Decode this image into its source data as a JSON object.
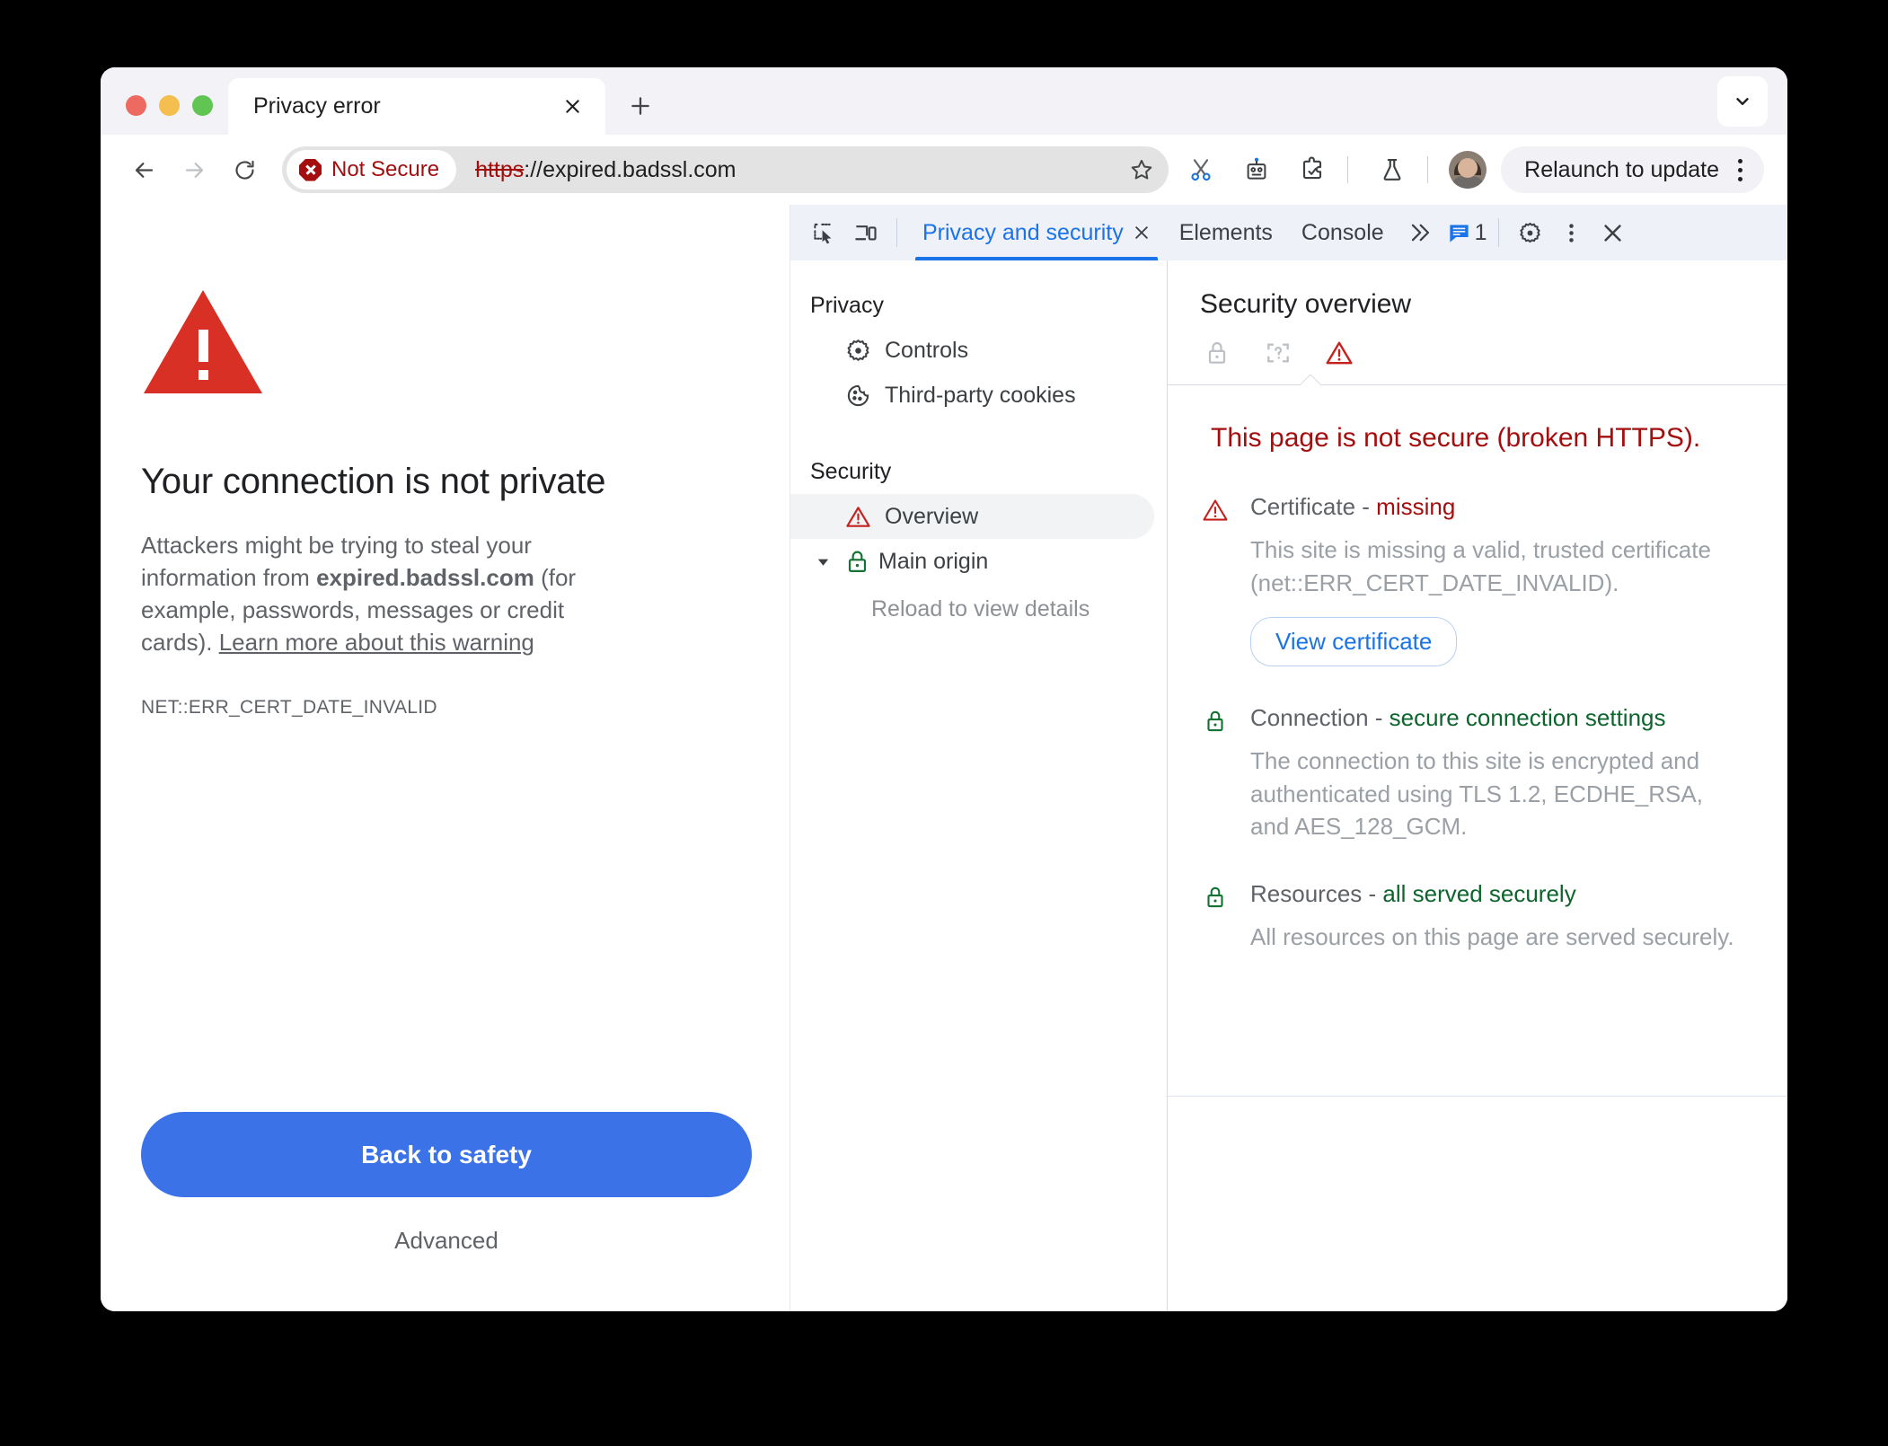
{
  "window": {
    "traffic_lights": [
      "close",
      "minimize",
      "maximize"
    ]
  },
  "tabstrip": {
    "tab_title": "Privacy error",
    "close_tab_label": "Close tab",
    "new_tab_label": "New Tab",
    "tab_search_label": "Search tabs"
  },
  "toolbar": {
    "back_label": "Back",
    "forward_label": "Forward",
    "reload_label": "Reload",
    "security_chip": "Not Secure",
    "url_scheme": "https",
    "url_separator": "://",
    "url_host": "expired.badssl.com",
    "bookmark_label": "Bookmark this tab",
    "icons": [
      "scissors-icon",
      "robot-icon",
      "extension-icon",
      "flask-icon"
    ],
    "profile_label": "Profile",
    "relaunch_label": "Relaunch to update",
    "menu_label": "Customize and control Google Chrome"
  },
  "page": {
    "title": "Your connection is not private",
    "body_part1": "Attackers might be trying to steal your information from ",
    "host": "expired.badssl.com",
    "body_part2": " (for example, passwords, messages or credit cards). ",
    "learn_more": "Learn more about this warning",
    "error_code": "NET::ERR_CERT_DATE_INVALID",
    "back_to_safety": "Back to safety",
    "advanced": "Advanced"
  },
  "devtools": {
    "toolbar_icons": [
      "inspect-element-icon",
      "device-toolbar-icon"
    ],
    "tabs": [
      {
        "label": "Privacy and security",
        "active": true,
        "closable": true
      },
      {
        "label": "Elements",
        "active": false,
        "closable": false
      },
      {
        "label": "Console",
        "active": false,
        "closable": false
      }
    ],
    "more_tabs_label": "More tabs",
    "issues_count": "1",
    "settings_label": "Settings",
    "more_options_label": "More options",
    "close_label": "Close DevTools",
    "sidebar": {
      "groups": [
        {
          "title": "Privacy",
          "items": [
            {
              "label": "Controls",
              "icon": "gear-icon",
              "selected": false
            },
            {
              "label": "Third-party cookies",
              "icon": "cookie-icon",
              "selected": false
            }
          ]
        },
        {
          "title": "Security",
          "items": [
            {
              "label": "Overview",
              "icon": "warning-triangle-icon",
              "selected": true
            },
            {
              "label": "Main origin",
              "icon": "lock-icon",
              "selected": false,
              "caret": true
            }
          ]
        }
      ],
      "sub_note": "Reload to view details"
    },
    "overview": {
      "title": "Security overview",
      "state_icons": [
        {
          "name": "lock-icon",
          "state": "inactive"
        },
        {
          "name": "unknown-box-icon",
          "state": "inactive"
        },
        {
          "name": "warning-triangle-icon",
          "state": "active"
        }
      ],
      "summary": "This page is not secure (broken HTTPS).",
      "sections": [
        {
          "icon": "warning-triangle-icon",
          "icon_state": "error",
          "label": "Certificate - ",
          "value": "missing",
          "value_state": "bad",
          "description": "This site is missing a valid, trusted certificate (net::ERR_CERT_DATE_INVALID).",
          "button": "View certificate"
        },
        {
          "icon": "lock-icon",
          "icon_state": "ok",
          "label": "Connection - ",
          "value": "secure connection settings",
          "value_state": "good",
          "description": "The connection to this site is encrypted and authenticated using TLS 1.2, ECDHE_RSA, and AES_128_GCM.",
          "button": null
        },
        {
          "icon": "lock-icon",
          "icon_state": "ok",
          "label": "Resources - ",
          "value": "all served securely",
          "value_state": "good",
          "description": "All resources on this page are served securely.",
          "button": null
        }
      ]
    }
  },
  "colors": {
    "danger": "#a50e0e",
    "warning_triangle": "#d93025",
    "success": "#0d652d",
    "accent_blue": "#1a73e8",
    "button_blue": "#3b72e8"
  }
}
